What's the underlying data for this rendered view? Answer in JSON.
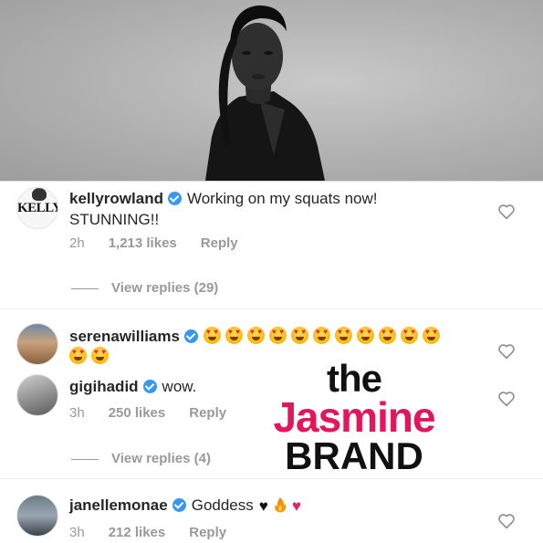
{
  "comments": [
    {
      "username": "kellyrowland",
      "avatar_text": "KELLY",
      "text": "Working on my squats now!",
      "text_line2": "STUNNING!!",
      "time": "2h",
      "likes": "1,213 likes",
      "reply": "Reply",
      "view_replies": "View replies (29)"
    },
    {
      "username": "serenawilliams",
      "emoji_name": "heart-eyes-emoji",
      "emoji_count": 13
    },
    {
      "username": "gigihadid",
      "text": "wow.",
      "time": "3h",
      "likes": "250 likes",
      "reply": "Reply",
      "view_replies": "View replies (4)"
    },
    {
      "username": "janellemonae",
      "text": "Goddess",
      "symbols": [
        "black-heart-icon",
        "fire-icon",
        "red-heart-icon"
      ],
      "time": "3h",
      "likes": "212 likes",
      "reply": "Reply"
    }
  ],
  "watermark": {
    "the": "the",
    "jasmine": "Jasmine",
    "brand": "BRAND"
  },
  "colors": {
    "verified": "#3897f0",
    "meta": "#999999",
    "watermark_pink": "#e3165b"
  }
}
